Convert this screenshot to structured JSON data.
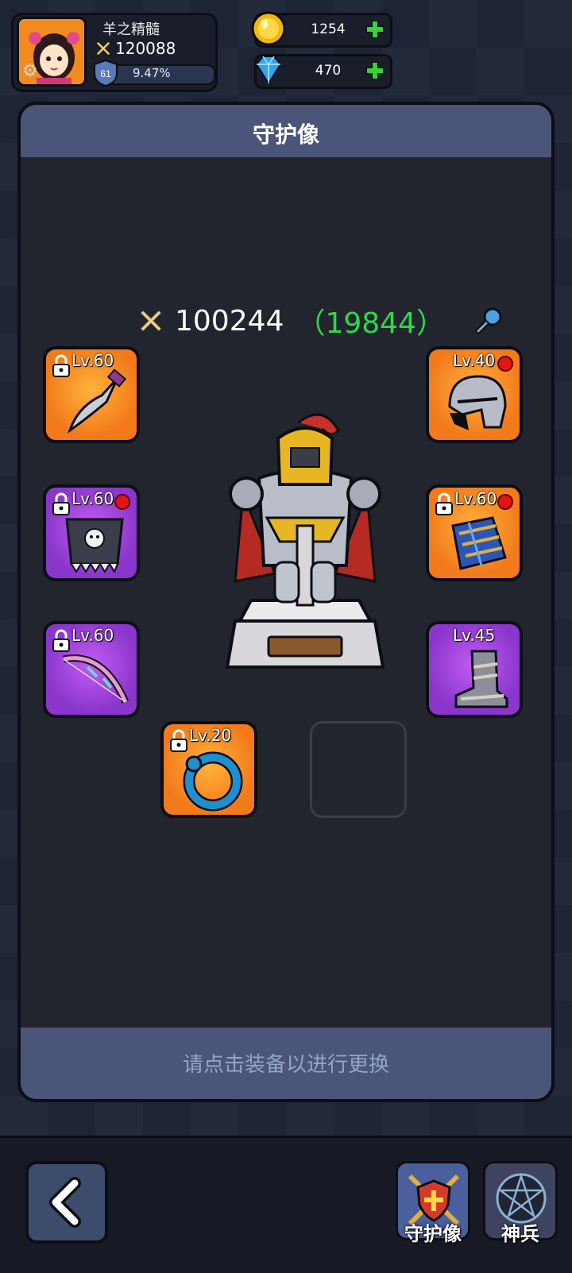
{
  "player": {
    "name": "羊之精髓",
    "power": "120088",
    "level": "61",
    "exp_percent": "9.47%",
    "exp_fraction": 0.0947
  },
  "resources": {
    "gold": "1254",
    "gems": "470"
  },
  "panel": {
    "title": "守护像",
    "power": "100244",
    "power_bonus": "（19844）",
    "hint": "请点击装备以进行更换"
  },
  "slots": [
    {
      "level": "Lv.60",
      "rarity": "orange",
      "item": "dagger",
      "locked": true,
      "alert": false
    },
    {
      "level": "Lv.40",
      "rarity": "orange",
      "item": "helmet",
      "locked": false,
      "alert": true
    },
    {
      "level": "Lv.60",
      "rarity": "purple",
      "item": "spiked-armor",
      "locked": true,
      "alert": true
    },
    {
      "level": "Lv.60",
      "rarity": "orange",
      "item": "gauntlets",
      "locked": true,
      "alert": true
    },
    {
      "level": "Lv.60",
      "rarity": "purple",
      "item": "bow",
      "locked": true,
      "alert": false
    },
    {
      "level": "Lv.45",
      "rarity": "purple",
      "item": "boots",
      "locked": false,
      "alert": false
    },
    {
      "level": "Lv.20",
      "rarity": "orange",
      "item": "ring",
      "locked": true,
      "alert": false
    }
  ],
  "nav": {
    "guardian_label": "守护像",
    "weapon_label": "神兵"
  },
  "colors": {
    "accent_green": "#2fd84a",
    "panel_header": "#4b5479",
    "orange_rarity": "#f27a1a",
    "purple_rarity": "#8a36cc"
  }
}
